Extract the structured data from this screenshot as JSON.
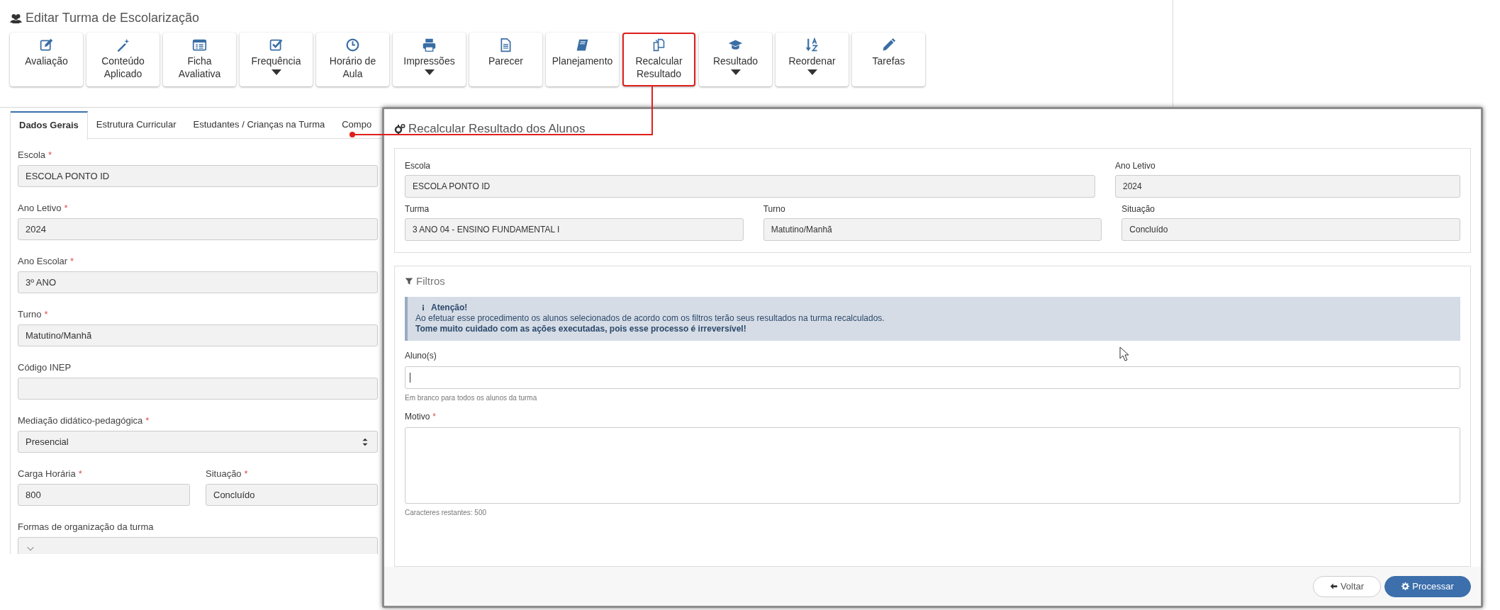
{
  "page": {
    "title": "Editar Turma de Escolarização"
  },
  "toolbar": [
    {
      "label": "Avaliação",
      "dropdown": false,
      "highlighted": false
    },
    {
      "label": "Conteúdo Aplicado",
      "dropdown": false,
      "highlighted": false
    },
    {
      "label": "Ficha Avaliativa",
      "dropdown": false,
      "highlighted": false
    },
    {
      "label": "Frequência",
      "dropdown": true,
      "highlighted": false
    },
    {
      "label": "Horário de Aula",
      "dropdown": false,
      "highlighted": false
    },
    {
      "label": "Impressões",
      "dropdown": true,
      "highlighted": false
    },
    {
      "label": "Parecer",
      "dropdown": false,
      "highlighted": false
    },
    {
      "label": "Planejamento",
      "dropdown": false,
      "highlighted": false
    },
    {
      "label": "Recalcular Resultado",
      "dropdown": false,
      "highlighted": true
    },
    {
      "label": "Resultado",
      "dropdown": true,
      "highlighted": false
    },
    {
      "label": "Reordenar",
      "dropdown": true,
      "highlighted": false
    },
    {
      "label": "Tarefas",
      "dropdown": false,
      "highlighted": false
    }
  ],
  "tabs": [
    {
      "label": "Dados Gerais",
      "selected": true
    },
    {
      "label": "Estrutura Curricular",
      "selected": false
    },
    {
      "label": "Estudantes / Crianças na Turma",
      "selected": false
    },
    {
      "label": "Compo",
      "selected": false
    }
  ],
  "form": {
    "rows": [
      [
        {
          "label": "Escola",
          "required_mark": "*",
          "value": "ESCOLA PONTO ID",
          "kind": "text"
        }
      ],
      [
        {
          "label": "Ano Letivo",
          "required_mark": "*",
          "value": "2024",
          "kind": "text"
        }
      ],
      [
        {
          "label": "Ano Escolar",
          "required_mark": "*",
          "value": "3º ANO",
          "kind": "text"
        }
      ],
      [
        {
          "label": "Turno",
          "required_mark": "*",
          "value": "Matutino/Manhã",
          "kind": "text"
        }
      ],
      [
        {
          "label": "Código INEP",
          "kind": "text"
        }
      ],
      [
        {
          "label": "Mediação didático-pedagógica",
          "required_mark": "*",
          "value": "Presencial",
          "kind": "select"
        }
      ],
      [
        {
          "label": "Carga Horária",
          "required_mark": "*",
          "value": "800",
          "kind": "text"
        },
        {
          "label": "Situação",
          "required_mark": "*",
          "value": "Concluído",
          "kind": "text"
        }
      ],
      [
        {
          "label": "Formas de organização da turma",
          "kind": "combo"
        }
      ]
    ]
  },
  "modal": {
    "title": "Recalcular Resultado dos Alunos",
    "info_rows": [
      [
        {
          "label": "Escola",
          "value": "ESCOLA PONTO ID"
        },
        {
          "label": "Ano Letivo",
          "value": "2024"
        }
      ],
      [
        {
          "label": "Turma",
          "value": "3 ANO 04 - ENSINO FUNDAMENTAL I"
        },
        {
          "label": "Turno",
          "value": "Matutino/Manhã"
        },
        {
          "label": "Situação",
          "value": "Concluído"
        }
      ]
    ],
    "filters": {
      "title": "Filtros",
      "alert": {
        "title": "Atenção!",
        "lines": [
          {
            "text": "Ao efetuar esse procedimento os alunos selecionados de acordo com os filtros terão seus resultados na turma recalculados.",
            "bold": false
          },
          {
            "text": "Tome muito cuidado com as ações executadas, pois esse processo é irreversível!",
            "bold": true
          }
        ]
      },
      "students": {
        "label": "Aluno(s)",
        "focused": true,
        "help": "Em branco para todos os alunos da turma"
      },
      "reason": {
        "label": "Motivo",
        "required_mark": "*",
        "counter": "Caracteres restantes: 500"
      }
    },
    "buttons": [
      {
        "label": "Voltar",
        "kind": "default"
      },
      {
        "label": "Processar",
        "kind": "primary"
      }
    ]
  }
}
